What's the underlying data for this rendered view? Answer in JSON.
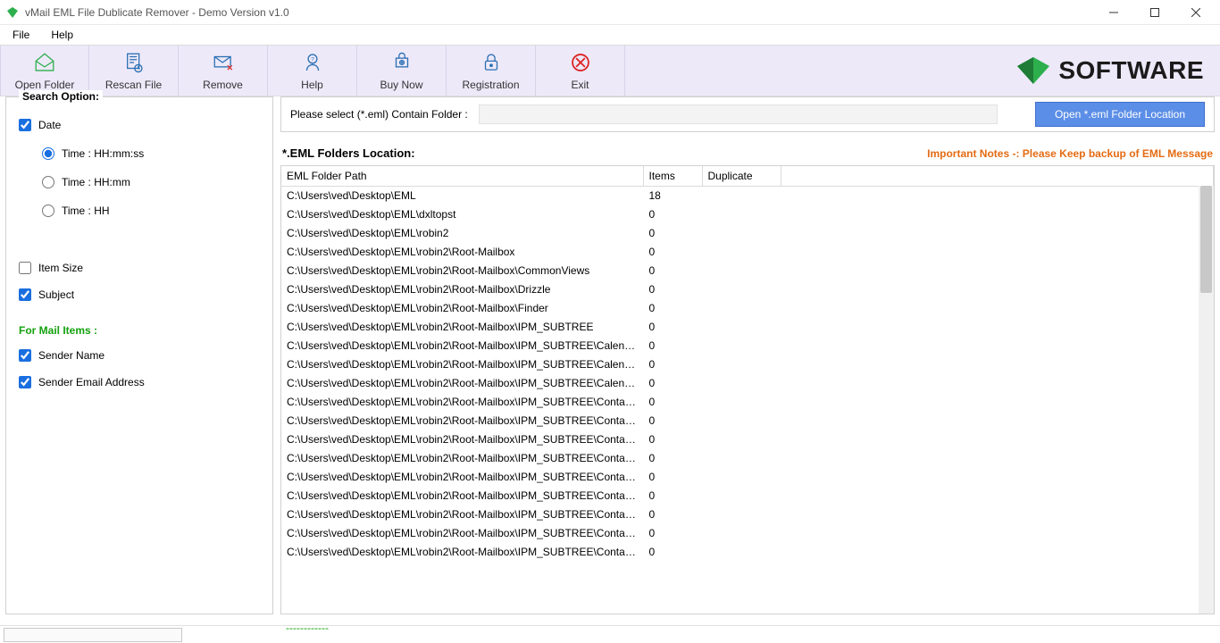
{
  "window": {
    "title": "vMail EML File Dublicate Remover - Demo Version v1.0"
  },
  "menubar": {
    "file": "File",
    "help": "Help"
  },
  "toolbar": {
    "open_folder": "Open Folder",
    "rescan_file": "Rescan File",
    "remove": "Remove",
    "help": "Help",
    "buy_now": "Buy Now",
    "registration": "Registration",
    "exit": "Exit",
    "brand": "SOFTWARE"
  },
  "search_option": {
    "title": "Search Option:",
    "date_label": "Date",
    "date_checked": true,
    "radios": {
      "hhmmss": "Time : HH:mm:ss",
      "hhmm": "Time : HH:mm",
      "hh": "Time : HH",
      "selected": "hhmmss"
    },
    "item_size_label": "Item Size",
    "item_size_checked": false,
    "subject_label": "Subject",
    "subject_checked": true,
    "mail_heading": "For Mail Items :",
    "sender_name_label": "Sender Name",
    "sender_name_checked": true,
    "sender_email_label": "Sender Email Address",
    "sender_email_checked": true
  },
  "path_row": {
    "label": "Please select (*.eml) Contain Folder :",
    "value": "",
    "button": "Open *.eml Folder Location"
  },
  "list": {
    "title": "*.EML Folders Location:",
    "note": "Important Notes -:  Please Keep backup of EML Message",
    "columns": {
      "path": "EML Folder Path",
      "items": "Items",
      "dup": "Duplicate"
    },
    "rows": [
      {
        "path": "C:\\Users\\ved\\Desktop\\EML",
        "items": "18",
        "dup": ""
      },
      {
        "path": "C:\\Users\\ved\\Desktop\\EML\\dxltopst",
        "items": "0",
        "dup": ""
      },
      {
        "path": "C:\\Users\\ved\\Desktop\\EML\\robin2",
        "items": "0",
        "dup": ""
      },
      {
        "path": "C:\\Users\\ved\\Desktop\\EML\\robin2\\Root-Mailbox",
        "items": "0",
        "dup": ""
      },
      {
        "path": "C:\\Users\\ved\\Desktop\\EML\\robin2\\Root-Mailbox\\CommonViews",
        "items": "0",
        "dup": ""
      },
      {
        "path": "C:\\Users\\ved\\Desktop\\EML\\robin2\\Root-Mailbox\\Drizzle",
        "items": "0",
        "dup": ""
      },
      {
        "path": "C:\\Users\\ved\\Desktop\\EML\\robin2\\Root-Mailbox\\Finder",
        "items": "0",
        "dup": ""
      },
      {
        "path": "C:\\Users\\ved\\Desktop\\EML\\robin2\\Root-Mailbox\\IPM_SUBTREE",
        "items": "0",
        "dup": ""
      },
      {
        "path": "C:\\Users\\ved\\Desktop\\EML\\robin2\\Root-Mailbox\\IPM_SUBTREE\\Calendar",
        "items": "0",
        "dup": ""
      },
      {
        "path": "C:\\Users\\ved\\Desktop\\EML\\robin2\\Root-Mailbox\\IPM_SUBTREE\\Calendar\\Cale...",
        "items": "0",
        "dup": ""
      },
      {
        "path": "C:\\Users\\ved\\Desktop\\EML\\robin2\\Root-Mailbox\\IPM_SUBTREE\\Calendar\\Cale...",
        "items": "0",
        "dup": ""
      },
      {
        "path": "C:\\Users\\ved\\Desktop\\EML\\robin2\\Root-Mailbox\\IPM_SUBTREE\\Contacts",
        "items": "0",
        "dup": ""
      },
      {
        "path": "C:\\Users\\ved\\Desktop\\EML\\robin2\\Root-Mailbox\\IPM_SUBTREE\\Contacts\\Boo...",
        "items": "0",
        "dup": ""
      },
      {
        "path": "C:\\Users\\ved\\Desktop\\EML\\robin2\\Root-Mailbox\\IPM_SUBTREE\\Contacts\\Cre...",
        "items": "0",
        "dup": ""
      },
      {
        "path": "C:\\Users\\ved\\Desktop\\EML\\robin2\\Root-Mailbox\\IPM_SUBTREE\\Contacts\\Dut...",
        "items": "0",
        "dup": ""
      },
      {
        "path": "C:\\Users\\ved\\Desktop\\EML\\robin2\\Root-Mailbox\\IPM_SUBTREE\\Contacts\\Dut...",
        "items": "0",
        "dup": ""
      },
      {
        "path": "C:\\Users\\ved\\Desktop\\EML\\robin2\\Root-Mailbox\\IPM_SUBTREE\\Contacts\\EM...",
        "items": "0",
        "dup": ""
      },
      {
        "path": "C:\\Users\\ved\\Desktop\\EML\\robin2\\Root-Mailbox\\IPM_SUBTREE\\Contacts\\Holi...",
        "items": "0",
        "dup": ""
      },
      {
        "path": "C:\\Users\\ved\\Desktop\\EML\\robin2\\Root-Mailbox\\IPM_SUBTREE\\Contacts\\Jac...",
        "items": "0",
        "dup": ""
      },
      {
        "path": "C:\\Users\\ved\\Desktop\\EML\\robin2\\Root-Mailbox\\IPM_SUBTREE\\Contacts\\Jav...",
        "items": "0",
        "dup": ""
      }
    ]
  },
  "footer_dashes": "------------"
}
